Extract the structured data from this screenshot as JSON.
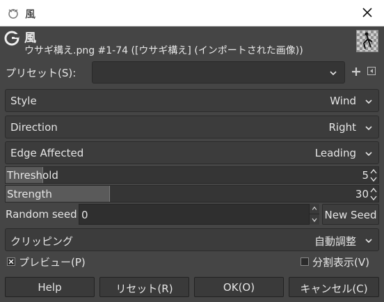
{
  "window": {
    "title": "風",
    "close_icon": "close-icon"
  },
  "header": {
    "filter_name": "風",
    "image_info": "ウサギ構え.png #1-74 ([ウサギ構え] (インポートされた画像))"
  },
  "presets": {
    "label": "プリセット(S):",
    "value": ""
  },
  "style": {
    "label": "Style",
    "value": "Wind"
  },
  "direction": {
    "label": "Direction",
    "value": "Right"
  },
  "edge": {
    "label": "Edge Affected",
    "value": "Leading"
  },
  "threshold": {
    "label": "Threshold",
    "value": "5",
    "fraction": 0.1
  },
  "strength": {
    "label": "Strength",
    "value": "30",
    "fraction": 0.28
  },
  "seed": {
    "label": "Random seed",
    "value": "0",
    "new_seed_label": "New Seed"
  },
  "clipping": {
    "label": "クリッピング",
    "value": "自動調整"
  },
  "preview": {
    "label": "プレビュー(P)",
    "checked": true
  },
  "split": {
    "label": "分割表示(V)",
    "checked": false
  },
  "buttons": {
    "help": "Help",
    "reset": "リセット(R)",
    "ok": "OK(O)",
    "cancel": "キャンセル(C)"
  }
}
